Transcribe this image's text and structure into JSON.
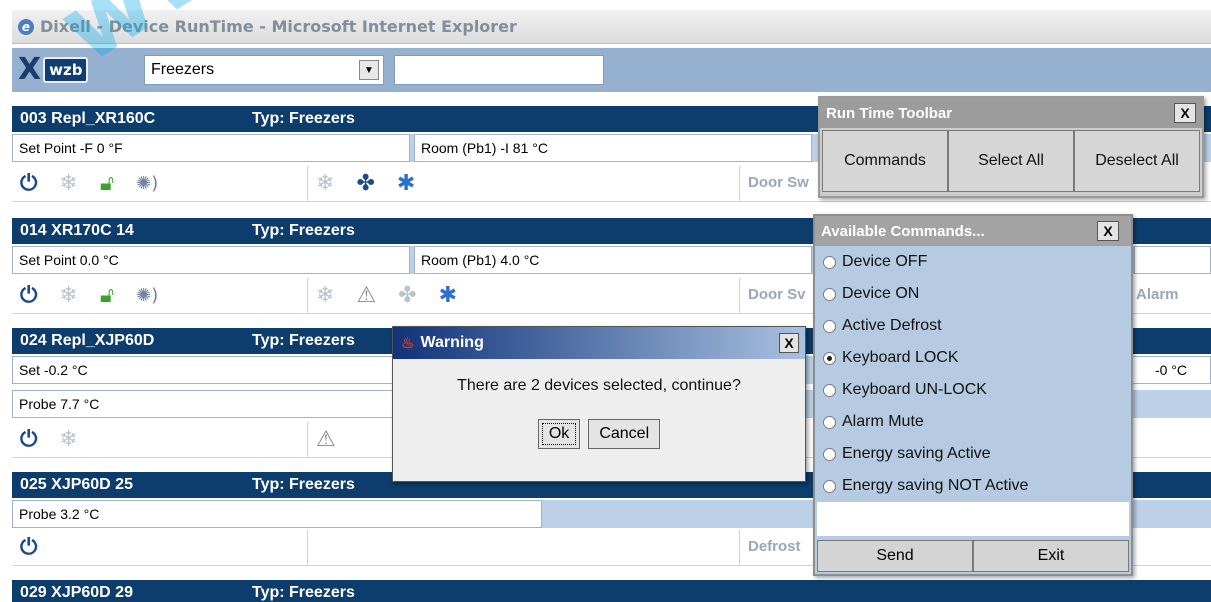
{
  "window": {
    "title": "Dixell - Device RunTime - Microsoft Internet Explorer"
  },
  "toolbar": {
    "logo_x": "X",
    "logo_text": "wzb",
    "group_select": "Freezers",
    "search_value": ""
  },
  "devices": [
    {
      "name": "003 Repl_XR160C",
      "typ": "Typ: Freezers",
      "f1": "Set Point -F   0 °F",
      "f2": "Room (Pb1) -I   81 °C",
      "status": "Door Sw"
    },
    {
      "name": "014 XR170C  14",
      "typ": "Typ: Freezers",
      "f1": "Set Point   0.0 °C",
      "f2": "Room (Pb1)   4.0 °C",
      "status": "Door Sv",
      "status2": "Alarm"
    },
    {
      "name": "024 Repl_XJP60D",
      "typ": "Typ: Freezers",
      "f1": "Set  -0.2 °C",
      "f2": "Probe  7.7 °C",
      "f3": "-0 °C"
    },
    {
      "name": "025 XJP60D  25",
      "typ": "Typ: Freezers",
      "f1": "Probe  3.2 °C",
      "status": "Defrost"
    },
    {
      "name": "029 XJP60D  29",
      "typ": "Typ: Freezers"
    }
  ],
  "runtime_toolbar": {
    "title": "Run Time Toolbar",
    "close": "X",
    "buttons": [
      "Commands",
      "Select All",
      "Deselect All"
    ]
  },
  "commands": {
    "title": "Available Commands...",
    "close": "X",
    "options": [
      "Device OFF",
      "Device ON",
      "Active Defrost",
      "Keyboard LOCK",
      "Keyboard UN-LOCK",
      "Alarm Mute",
      "Energy saving Active",
      "Energy saving NOT Active"
    ],
    "selected_index": 3,
    "send": "Send",
    "exit": "Exit"
  },
  "warning": {
    "title": "Warning",
    "close": "X",
    "message": "There are 2 devices selected, continue?",
    "ok": "Ok",
    "cancel": "Cancel"
  },
  "watermark": "www.pho"
}
